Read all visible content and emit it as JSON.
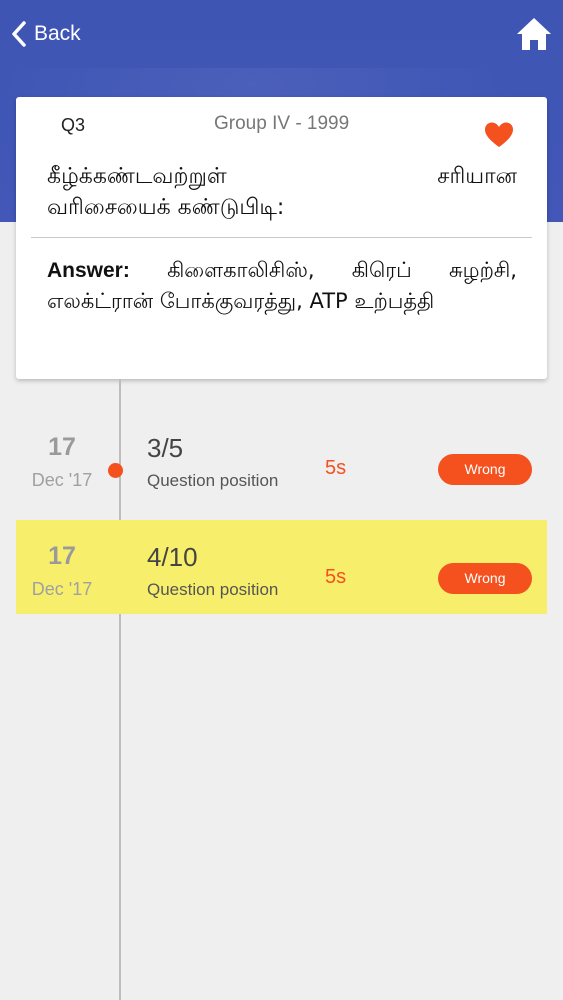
{
  "topbar": {
    "back_label": "Back",
    "back_icon": "chevron-left-icon",
    "home_icon": "home-icon"
  },
  "question": {
    "number": "Q3",
    "group": "Group IV - 1999",
    "favorite_icon": "heart-icon",
    "text_line1": "கீழ்க்கண்டவற்றுள் சரியான",
    "text_line2": "வரிசையைக் கண்டுபிடி:",
    "answer_label": "Answer:",
    "answer_text": "கிளைகாலிசிஸ், கிரெப் சுழற்சி, எலக்ட்ரான் போக்குவரத்து, ATP உற்பத்தி"
  },
  "attempts": [
    {
      "day": "17",
      "month": "Dec '17",
      "position": "3/5",
      "position_label": "Question position",
      "time": "5s",
      "result": "Wrong",
      "highlighted": false
    },
    {
      "day": "17",
      "month": "Dec '17",
      "position": "4/10",
      "position_label": "Question position",
      "time": "5s",
      "result": "Wrong",
      "highlighted": true
    }
  ],
  "colors": {
    "header": "#4257b7",
    "accent": "#f4511e",
    "highlight": "#f7ef6c",
    "background": "#efefef"
  }
}
